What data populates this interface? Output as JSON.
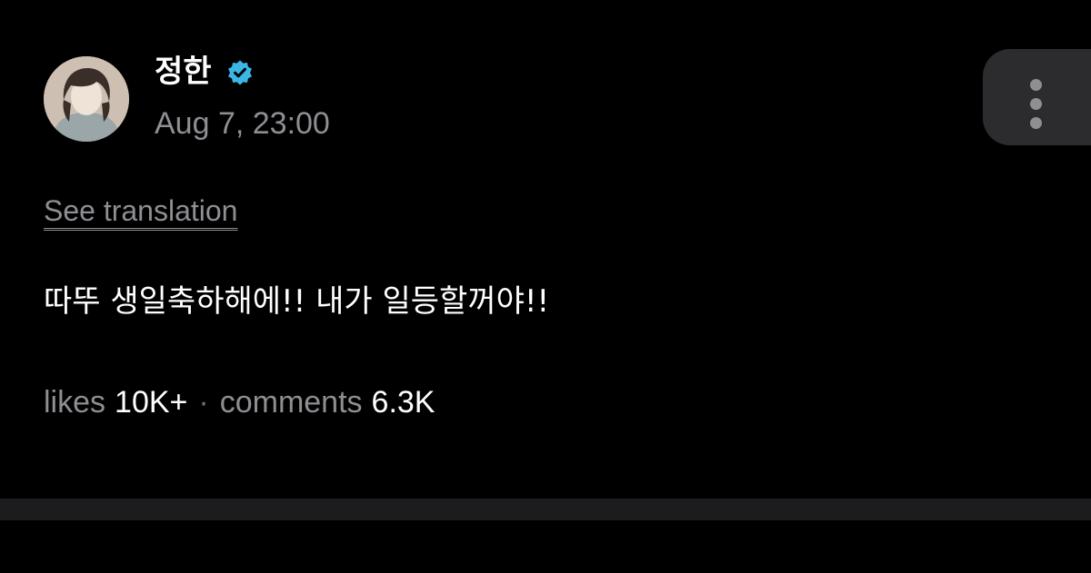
{
  "post": {
    "author": {
      "name": "정한",
      "verified_icon": "verified-badge-icon",
      "avatar_icon": "profile-photo"
    },
    "timestamp": "Aug 7, 23:00",
    "more_icon": "more-vertical-icon",
    "see_translation_label": "See translation",
    "body_text": "따뚜 생일축하해에!! 내가 일등할꺼야!!",
    "stats": {
      "likes_label": "likes",
      "likes_count": "10K+",
      "separator": "·",
      "comments_label": "comments",
      "comments_count": "6.3K"
    }
  },
  "colors": {
    "background": "#000000",
    "text_primary": "#ffffff",
    "text_secondary": "#8e8e93",
    "verified_badge": "#3bb7e6",
    "more_button_bg": "#2c2c2e",
    "divider_band": "#1c1c1e"
  }
}
